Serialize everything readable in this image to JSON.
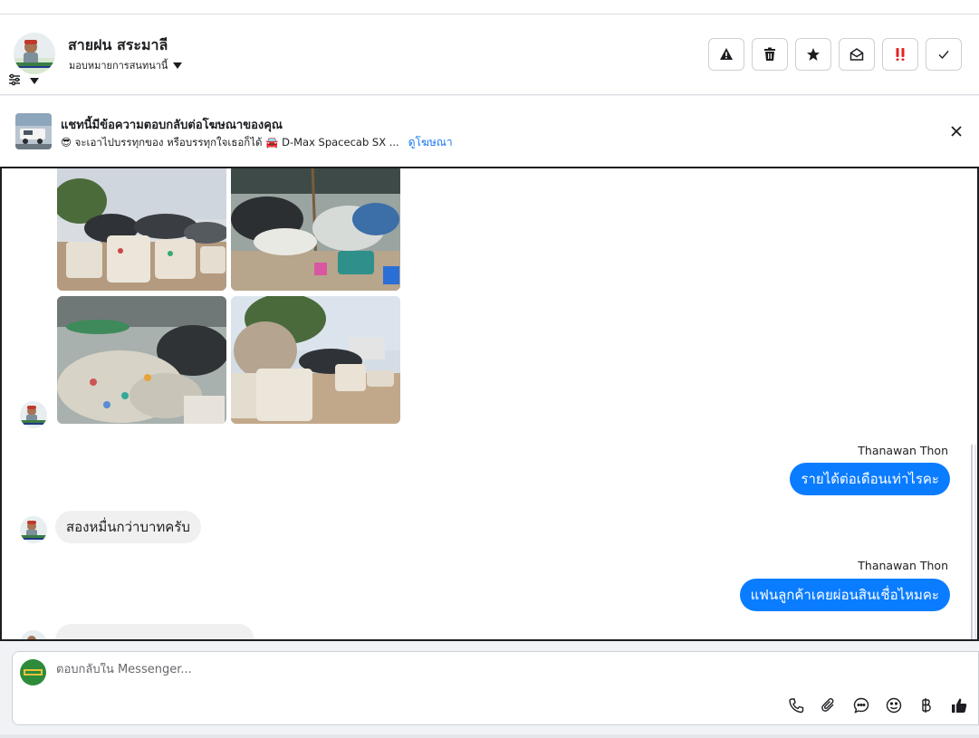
{
  "header": {
    "contact_name": "สายฝน สระมาลี",
    "assign_label": "มอบหมายการสนทนานี้"
  },
  "ad_banner": {
    "title": "แชทนี้มีข้อความตอบกลับต่อโฆษณาของคุณ",
    "subtitle": "😎 จะเอาไปบรรทุกของ หรือบรรทุกใจเธอก็ได้ 🚘 D-Max Spacecab SX ...",
    "link_label": "ดูโฆษณา"
  },
  "messages": [
    {
      "direction": "outgoing",
      "sender": "Thanawan Thon",
      "text": "รายได้ต่อเดือนเท่าไรคะ"
    },
    {
      "direction": "incoming",
      "text": "สองหมื่นกว่าบาทครับ"
    },
    {
      "direction": "outgoing",
      "sender": "Thanawan Thon",
      "text": "แฟนลูกค้าเคยผ่อนสินเชื่อไหมคะ"
    }
  ],
  "composer": {
    "placeholder": "ตอบกลับใน Messenger..."
  },
  "actions": [
    "alert-icon",
    "trash-icon",
    "star-icon",
    "envelope-open-icon",
    "double-exclamation-icon",
    "check-icon"
  ],
  "tools": [
    "phone-icon",
    "paperclip-icon",
    "chat-bubble-icon",
    "emoji-icon",
    "baht-icon",
    "thumbs-up-icon"
  ],
  "colors": {
    "accent": "#0a7cff",
    "link": "#1877f2",
    "urgent": "#e02424"
  }
}
